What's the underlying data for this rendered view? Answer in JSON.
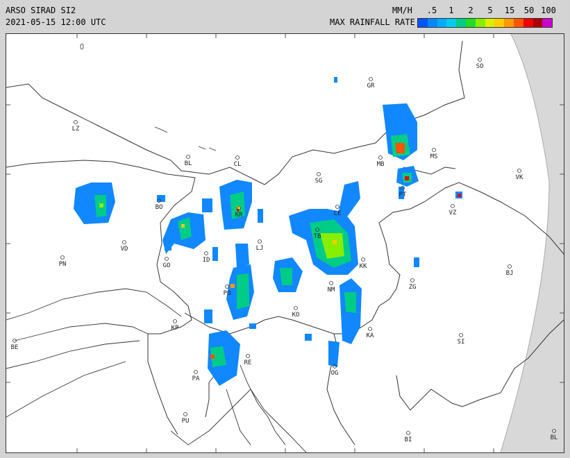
{
  "header": {
    "title": "ARSO SIRAD SI2",
    "timestamp": "2021-05-15 12:00 UTC",
    "units": "MM/H",
    "legend_title": "MAX RAINFALL RATE"
  },
  "legend": {
    "ticks": [
      ".5",
      "1",
      "2",
      "5",
      "15",
      "50",
      "100"
    ],
    "colors": [
      "#0055ff",
      "#0088ff",
      "#00aaff",
      "#00ccee",
      "#00cc88",
      "#22dd22",
      "#88ee00",
      "#ddee00",
      "#ffcc00",
      "#ff9900",
      "#ff5500",
      "#ee0000",
      "#aa0000",
      "#cc00cc"
    ]
  },
  "cities": [
    {
      "code": "SO"
    },
    {
      "code": "GR"
    },
    {
      "code": "LZ"
    },
    {
      "code": "MS"
    },
    {
      "code": "BL"
    },
    {
      "code": "CL"
    },
    {
      "code": "MB"
    },
    {
      "code": "VK"
    },
    {
      "code": "SG"
    },
    {
      "code": "PT"
    },
    {
      "code": "BO"
    },
    {
      "code": "CE"
    },
    {
      "code": "VZ"
    },
    {
      "code": "KR"
    },
    {
      "code": "TB"
    },
    {
      "code": "LJ"
    },
    {
      "code": "VD"
    },
    {
      "code": "KK"
    },
    {
      "code": "PN"
    },
    {
      "code": "GO"
    },
    {
      "code": "ID"
    },
    {
      "code": "BJ"
    },
    {
      "code": "ZG"
    },
    {
      "code": "NM"
    },
    {
      "code": "PO"
    },
    {
      "code": "KO"
    },
    {
      "code": "KP"
    },
    {
      "code": "KA"
    },
    {
      "code": "SI"
    },
    {
      "code": "BE"
    },
    {
      "code": "RE"
    },
    {
      "code": "PA"
    },
    {
      "code": "OG"
    },
    {
      "code": "PU"
    },
    {
      "code": "BI"
    },
    {
      "code": "BL"
    }
  ]
}
